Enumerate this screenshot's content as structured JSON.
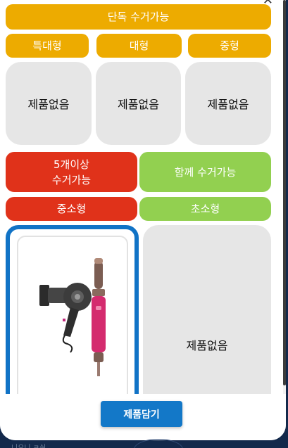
{
  "sections": {
    "single": {
      "header": "단독 수거가능",
      "sizes": [
        "특대형",
        "대형",
        "중형"
      ],
      "slots": [
        "제품없음",
        "제품없음",
        "제품없음"
      ]
    },
    "multi_label": "5개이상\n수거가능",
    "together_label": "함께 수거가능",
    "small_label": "중소형",
    "mini_label": "초소형",
    "mini_slot": "제품없음"
  },
  "product": {
    "icon": "hair-dryer-and-styler-image"
  },
  "cta_label": "제품담기",
  "behind_text": "니오니 ㅋ쉬",
  "colors": {
    "yellow": "#edab00",
    "red": "#e0321a",
    "green": "#92d050",
    "blue": "#1173c6",
    "slot_gray": "#e6e6e6"
  }
}
